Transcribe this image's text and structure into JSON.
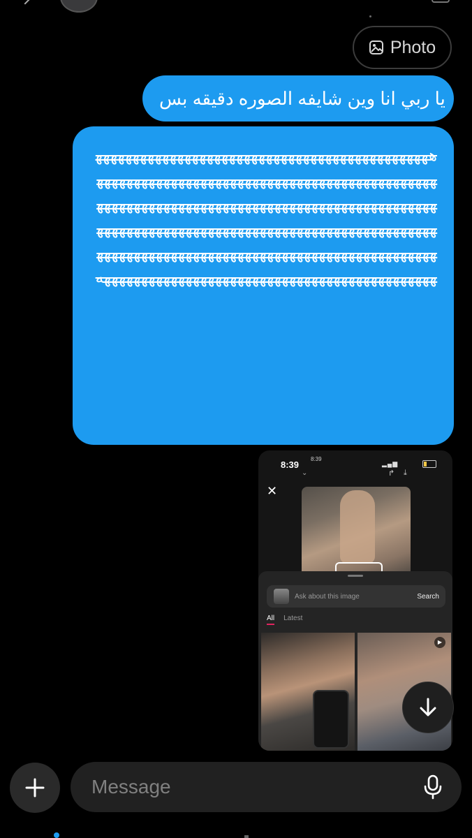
{
  "header": {
    "avatar": "avatar",
    "back_icon": "chevron-left-icon"
  },
  "messages": {
    "photo_pill": {
      "label": "Photo",
      "icon": "image-icon"
    },
    "bubble1": {
      "text": "يا ربي انا وين شايفه الصوره دقيقه بس"
    },
    "bubble2": {
      "text": "هههههههههههههههههههههههههههههههههههههههههههههههههههههههههههههههههههههههههههههههههههههههههههههههههههههههههههههههههههههههههههههههههههههههههههههههههههههههههههههههههههههههههههههههههههههههههههههههههههههههههههههههههههههههههههههههههههههههههههههههههههههههههههههههههههههههههههههههههههه"
    },
    "bubble_color": "#1d9bf0"
  },
  "screenshot": {
    "big_time": "8:39",
    "small_time": "8:39",
    "status": "▮▮▮▮",
    "ask_placeholder": "Ask about this image",
    "search_label": "Search",
    "tabs": [
      "All",
      "Latest"
    ],
    "active_tab": "All"
  },
  "scroll_down": {
    "icon": "arrow-down-icon"
  },
  "composer": {
    "add_icon": "plus-icon",
    "placeholder": "Message",
    "mic_icon": "microphone-icon"
  }
}
